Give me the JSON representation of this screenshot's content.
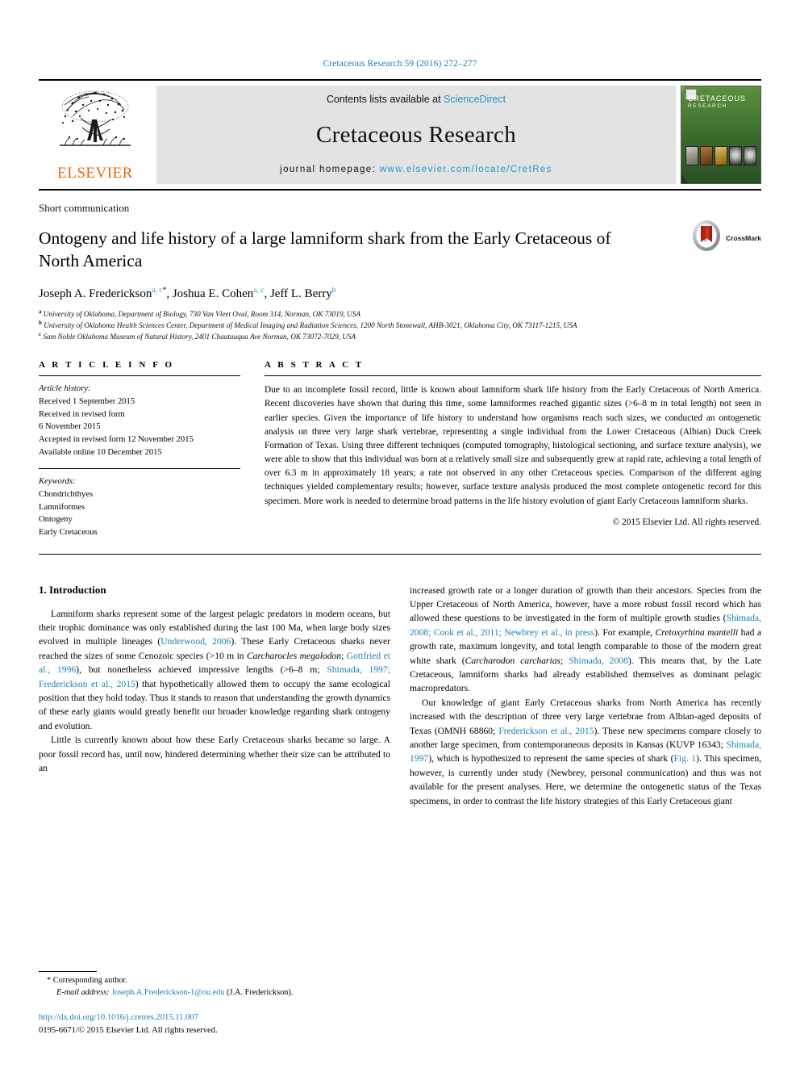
{
  "running_head": "Cretaceous Research 59 (2016) 272–277",
  "masthead": {
    "contents_prefix": "Contents lists available at ",
    "sciencedirect": "ScienceDirect",
    "journal_name": "Cretaceous Research",
    "homepage_prefix": "journal homepage: ",
    "homepage_url": "www.elsevier.com/locate/CretRes",
    "publisher": "ELSEVIER",
    "cover_title": "CRETACEOUS",
    "cover_subtitle": "RESEARCH"
  },
  "article": {
    "type_label": "Short communication",
    "title": "Ontogeny and life history of a large lamniform shark from the Early Cretaceous of North America",
    "crossmark_label": "CrossMark",
    "authors": [
      {
        "name": "Joseph A. Frederickson",
        "marks": "a, c",
        "star": "*"
      },
      {
        "name": "Joshua E. Cohen",
        "marks": "a, c",
        "star": ""
      },
      {
        "name": "Jeff L. Berry",
        "marks": "b",
        "star": ""
      }
    ],
    "affiliations": [
      {
        "mark": "a",
        "text": "University of Oklahoma, Department of Biology, 730 Van Vleet Oval, Room 314, Norman, OK 73019, USA"
      },
      {
        "mark": "b",
        "text": "University of Oklahoma Health Sciences Center, Department of Medical Imaging and Radiation Sciences, 1200 North Stonewall, AHB-3021, Oklahoma City, OK 73117-1215, USA"
      },
      {
        "mark": "c",
        "text": "Sam Noble Oklahoma Museum of Natural History, 2401 Chautauqua Ave Norman, OK 73072-7029, USA"
      }
    ]
  },
  "article_info": {
    "heading": "A R T I C L E  I N F O",
    "history_label": "Article history:",
    "history": [
      "Received 1 September 2015",
      "Received in revised form",
      "6 November 2015",
      "Accepted in revised form 12 November 2015",
      "Available online 10 December 2015"
    ],
    "keywords_label": "Keywords:",
    "keywords": [
      "Chondrichthyes",
      "Lamniformes",
      "Ontogeny",
      "Early Cretaceous"
    ]
  },
  "abstract": {
    "heading": "A B S T R A C T",
    "text": "Due to an incomplete fossil record, little is known about lamniform shark life history from the Early Cretaceous of North America. Recent discoveries have shown that during this time, some lamniformes reached gigantic sizes (>6–8 m in total length) not seen in earlier species. Given the importance of life history to understand how organisms reach such sizes, we conducted an ontogenetic analysis on three very large shark vertebrae, representing a single individual from the Lower Cretaceous (Albian) Duck Creek Formation of Texas. Using three different techniques (computed tomography, histological sectioning, and surface texture analysis), we were able to show that this individual was born at a relatively small size and subsequently grew at rapid rate, achieving a total length of over 6.3 m in approximately 18 years; a rate not observed in any other Cretaceous species. Comparison of the different aging techniques yielded complementary results; however, surface texture analysis produced the most complete ontogenetic record for this specimen. More work is needed to determine broad patterns in the life history evolution of giant Early Cretaceous lamniform sharks.",
    "copyright": "© 2015 Elsevier Ltd. All rights reserved."
  },
  "section": {
    "heading": "1. Introduction",
    "left_paragraphs": [
      "Lamniform sharks represent some of the largest pelagic predators in modern oceans, but their trophic dominance was only established during the last 100 Ma, when large body sizes evolved in multiple lineages (Underwood, 2006). These Early Cretaceous sharks never reached the sizes of some Cenozoic species (>10 m in Carcharocles megalodon; Gottfried et al., 1996), but nonetheless achieved impressive lengths (>6–8 m; Shimada, 1997; Frederickson et al., 2015) that hypothetically allowed them to occupy the same ecological position that they hold today. Thus it stands to reason that understanding the growth dynamics of these early giants would greatly benefit our broader knowledge regarding shark ontogeny and evolution.",
      "Little is currently known about how these Early Cretaceous sharks became so large. A poor fossil record has, until now, hindered determining whether their size can be attributed to an"
    ],
    "right_paragraphs": [
      "increased growth rate or a longer duration of growth than their ancestors. Species from the Upper Cretaceous of North America, however, have a more robust fossil record which has allowed these questions to be investigated in the form of multiple growth studies (Shimada, 2008; Cook et al., 2011; Newbrey et al., in press). For example, Cretoxyrhina mantelli had a growth rate, maximum longevity, and total length comparable to those of the modern great white shark (Carcharodon carcharias; Shimada, 2008). This means that, by the Late Cretaceous, lamniform sharks had already established themselves as dominant pelagic macropredators.",
      "Our knowledge of giant Early Cretaceous sharks from North America has recently increased with the description of three very large vertebrae from Albian-aged deposits of Texas (OMNH 68860; Frederickson et al., 2015). These new specimens compare closely to another large specimen, from contemporaneous deposits in Kansas (KUVP 16343; Shimada, 1997), which is hypothesized to represent the same species of shark (Fig. 1). This specimen, however, is currently under study (Newbrey, personal communication) and thus was not available for the present analyses. Here, we determine the ontogenetic status of the Texas specimens, in order to contrast the life history strategies of this Early Cretaceous giant"
    ]
  },
  "footnote": {
    "corresponding_mark": "*",
    "corresponding_label": "Corresponding author.",
    "email_label": "E-mail address:",
    "email": "Joseph.A.Frederickson-1@ou.edu",
    "email_owner": "(J.A. Frederickson).",
    "doi": "http://dx.doi.org/10.1016/j.cretres.2015.11.007",
    "issn_line": "0195-6671/© 2015 Elsevier Ltd. All rights reserved."
  },
  "colors": {
    "link": "#1a7fb5",
    "sciencedirect": "#2196c9",
    "elsevier_orange": "#ec6608",
    "masthead_gray": "#e3e3e3"
  }
}
